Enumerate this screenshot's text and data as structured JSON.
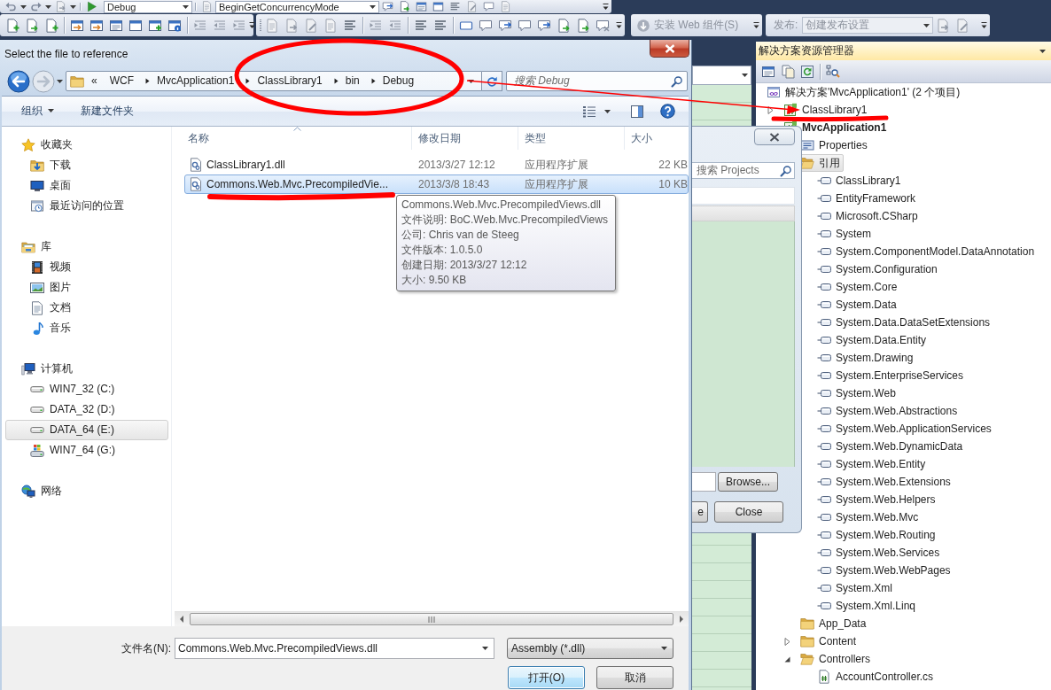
{
  "toolbar": {
    "configuration": {
      "value": "Debug"
    },
    "member": {
      "value": "BeginGetConcurrencyMode"
    },
    "web_components": {
      "label": "安装 Web 组件(S)",
      "disabled": true
    },
    "publish": {
      "label": "发布:",
      "value": "创建发布设置",
      "disabled": true
    }
  },
  "file_dialog": {
    "title": "Select the file to reference",
    "address": {
      "overflow": "«",
      "segments": [
        "WCF",
        "MvcApplication1",
        "ClassLibrary1",
        "bin",
        "Debug"
      ]
    },
    "search": {
      "placeholder": "搜索 Debug"
    },
    "commands": {
      "organize": "组织",
      "new_folder": "新建文件夹"
    },
    "navigation": [
      {
        "label": "收藏夹",
        "kind": "favorites",
        "selected": false,
        "items": [
          {
            "label": "下载",
            "kind": "downloads",
            "selected": false
          },
          {
            "label": "桌面",
            "kind": "desktop",
            "selected": false
          },
          {
            "label": "最近访问的位置",
            "kind": "recent",
            "selected": false
          }
        ]
      },
      {
        "label": "库",
        "kind": "libraries",
        "selected": false,
        "items": [
          {
            "label": "视频",
            "kind": "videos",
            "selected": false
          },
          {
            "label": "图片",
            "kind": "pictures",
            "selected": false
          },
          {
            "label": "文档",
            "kind": "documents",
            "selected": false
          },
          {
            "label": "音乐",
            "kind": "music",
            "selected": false
          }
        ]
      },
      {
        "label": "计算机",
        "kind": "computer",
        "selected": false,
        "items": [
          {
            "label": "WIN7_32 (C:)",
            "kind": "drive",
            "selected": false
          },
          {
            "label": "DATA_32 (D:)",
            "kind": "drive",
            "selected": false
          },
          {
            "label": "DATA_64 (E:)",
            "kind": "drive",
            "selected": true
          },
          {
            "label": "WIN7_64 (G:)",
            "kind": "system_drive",
            "selected": false
          }
        ]
      },
      {
        "label": "网络",
        "kind": "network",
        "selected": false
      }
    ],
    "file_list": {
      "columns": [
        {
          "label": "名称",
          "sorted": true
        },
        {
          "label": "修改日期",
          "sorted": false
        },
        {
          "label": "类型",
          "sorted": false
        },
        {
          "label": "大小",
          "sorted": false
        }
      ],
      "rows": [
        {
          "name": "ClassLibrary1.dll",
          "modified": "2013/3/27 12:12",
          "type": "应用程序扩展",
          "size": "22 KB",
          "selected": false
        },
        {
          "name": "Commons.Web.Mvc.PrecompiledVie...",
          "modified": "2013/3/8 18:43",
          "type": "应用程序扩展",
          "size": "10 KB",
          "selected": true
        }
      ]
    },
    "tooltip": [
      "Commons.Web.Mvc.PrecompiledViews.dll",
      "文件说明: BoC.Web.Mvc.PrecompiledViews",
      "公司: Chris van de Steeg",
      "文件版本: 1.0.5.0",
      "创建日期: 2013/3/27 12:12",
      "大小: 9.50 KB"
    ],
    "file_name": {
      "label": "文件名(N):",
      "value": "Commons.Web.Mvc.PrecompiledViews.dll"
    },
    "file_type": {
      "value": "Assembly (*.dll)"
    },
    "buttons": [
      {
        "label": "打开(O)",
        "default": true
      },
      {
        "label": "取消",
        "default": false
      }
    ]
  },
  "reference_dialog": {
    "search": {
      "placeholder": "搜索 Projects"
    },
    "browse_button": "Browse...",
    "buttons": [
      "e",
      "Close"
    ]
  },
  "solution_explorer": {
    "title": "解决方案资源管理器",
    "tree": [
      {
        "label": "解决方案'MvcApplication1' (2 个项目)",
        "kind": "solution",
        "selected": false,
        "children": [
          {
            "label": "ClassLibrary1",
            "kind": "project",
            "startup": false,
            "expanded": false,
            "selected": false
          },
          {
            "label": "MvcApplication1",
            "kind": "project",
            "startup": true,
            "selected": false,
            "children": [
              {
                "label": "Properties",
                "kind": "properties",
                "selected": false
              },
              {
                "label": "引用",
                "kind": "references",
                "selected": true,
                "children": [
                  {
                    "label": "ClassLibrary1",
                    "kind": "reference",
                    "selected": false
                  },
                  {
                    "label": "EntityFramework",
                    "kind": "reference",
                    "selected": false
                  },
                  {
                    "label": "Microsoft.CSharp",
                    "kind": "reference",
                    "selected": false
                  },
                  {
                    "label": "System",
                    "kind": "reference",
                    "selected": false
                  },
                  {
                    "label": "System.ComponentModel.DataAnnotation",
                    "kind": "reference",
                    "selected": false
                  },
                  {
                    "label": "System.Configuration",
                    "kind": "reference",
                    "selected": false
                  },
                  {
                    "label": "System.Core",
                    "kind": "reference",
                    "selected": false
                  },
                  {
                    "label": "System.Data",
                    "kind": "reference",
                    "selected": false
                  },
                  {
                    "label": "System.Data.DataSetExtensions",
                    "kind": "reference",
                    "selected": false
                  },
                  {
                    "label": "System.Data.Entity",
                    "kind": "reference",
                    "selected": false
                  },
                  {
                    "label": "System.Drawing",
                    "kind": "reference",
                    "selected": false
                  },
                  {
                    "label": "System.EnterpriseServices",
                    "kind": "reference",
                    "selected": false
                  },
                  {
                    "label": "System.Web",
                    "kind": "reference",
                    "selected": false
                  },
                  {
                    "label": "System.Web.Abstractions",
                    "kind": "reference",
                    "selected": false
                  },
                  {
                    "label": "System.Web.ApplicationServices",
                    "kind": "reference",
                    "selected": false
                  },
                  {
                    "label": "System.Web.DynamicData",
                    "kind": "reference",
                    "selected": false
                  },
                  {
                    "label": "System.Web.Entity",
                    "kind": "reference",
                    "selected": false
                  },
                  {
                    "label": "System.Web.Extensions",
                    "kind": "reference",
                    "selected": false
                  },
                  {
                    "label": "System.Web.Helpers",
                    "kind": "reference",
                    "selected": false
                  },
                  {
                    "label": "System.Web.Mvc",
                    "kind": "reference",
                    "selected": false
                  },
                  {
                    "label": "System.Web.Routing",
                    "kind": "reference",
                    "selected": false
                  },
                  {
                    "label": "System.Web.Services",
                    "kind": "reference",
                    "selected": false
                  },
                  {
                    "label": "System.Web.WebPages",
                    "kind": "reference",
                    "selected": false
                  },
                  {
                    "label": "System.Xml",
                    "kind": "reference",
                    "selected": false
                  },
                  {
                    "label": "System.Xml.Linq",
                    "kind": "reference",
                    "selected": false
                  }
                ]
              },
              {
                "label": "App_Data",
                "kind": "folder",
                "selected": false
              },
              {
                "label": "Content",
                "kind": "folder",
                "expanded": false,
                "selected": false
              },
              {
                "label": "Controllers",
                "kind": "folder",
                "expanded": true,
                "selected": false,
                "children": [
                  {
                    "label": "AccountController.cs",
                    "kind": "code_file",
                    "selected": false
                  }
                ]
              }
            ]
          }
        ]
      }
    ]
  }
}
